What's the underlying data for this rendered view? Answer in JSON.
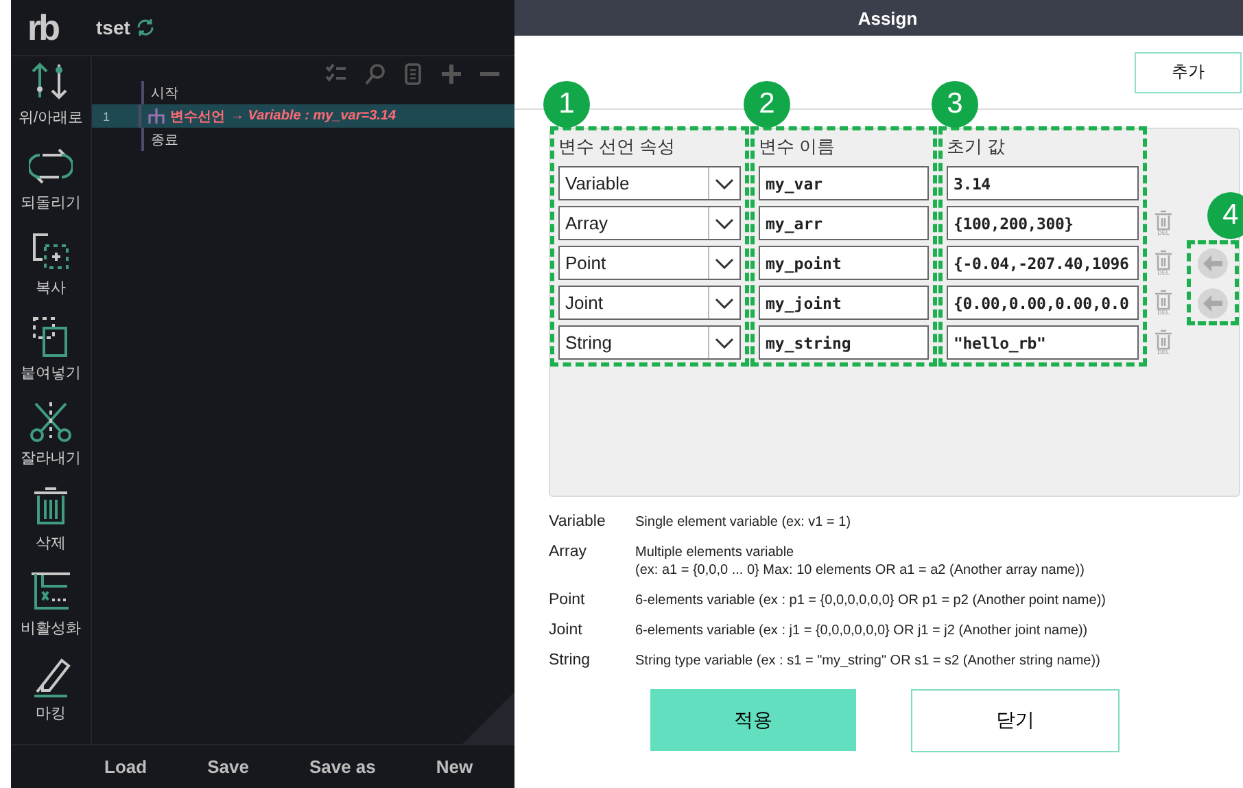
{
  "editor": {
    "logo": "rb",
    "project": "tset"
  },
  "toolbar": [
    {
      "label": "위/아래로"
    },
    {
      "label": "되돌리기"
    },
    {
      "label": "복사"
    },
    {
      "label": "붙여넣기"
    },
    {
      "label": "잘라내기"
    },
    {
      "label": "삭제"
    },
    {
      "label": "비활성화"
    },
    {
      "label": "마킹"
    }
  ],
  "tree": [
    {
      "kind": "start",
      "label": "시작",
      "selected": false
    },
    {
      "kind": "command",
      "number": "1",
      "label": "변수선언",
      "detail": "→ Variable : my_var=3.14",
      "selected": true
    },
    {
      "kind": "end",
      "label": "종료",
      "selected": false
    }
  ],
  "bottom_bar": [
    "Load",
    "Save",
    "Save as",
    "New"
  ],
  "dialog": {
    "title": "Assign",
    "add_button": "추가",
    "columns": [
      "변수 선언 속성",
      "변수 이름",
      "초기 값"
    ],
    "rows": [
      {
        "type": "Variable",
        "name": "my_var",
        "value": "3.14",
        "capture": false
      },
      {
        "type": "Array",
        "name": "my_arr",
        "value": "{100,200,300}",
        "delete_label": "DEL",
        "capture": false
      },
      {
        "type": "Point",
        "name": "my_point",
        "value": "{-0.04,-207.40,1096",
        "delete_label": "DEL",
        "capture": true
      },
      {
        "type": "Joint",
        "name": "my_joint",
        "value": "{0.00,0.00,0.00,0.0",
        "delete_label": "DEL",
        "capture": true
      },
      {
        "type": "String",
        "name": "my_string",
        "value": "\"hello_rb\"",
        "delete_label": "DEL",
        "capture": false
      }
    ],
    "markers": [
      "1",
      "2",
      "3",
      "4"
    ],
    "legend": [
      {
        "term": "Variable",
        "description": "Single element variable (ex: v1 = 1)"
      },
      {
        "term": "Array",
        "description": "Multiple elements variable\n(ex: a1 = {0,0,0 ... 0} Max: 10 elements OR a1 = a2 (Another array name))"
      },
      {
        "term": "Point",
        "description": "6-elements variable (ex : p1 = {0,0,0,0,0,0}  OR  p1 = p2 (Another point name))"
      },
      {
        "term": "Joint",
        "description": "6-elements variable (ex : j1 = {0,0,0,0,0,0}  OR  j1 = j2 (Another joint name))"
      },
      {
        "term": "String",
        "description": "String type variable (ex : s1 = \"my_string\"  OR  s1 = s2 (Another string name))"
      }
    ],
    "apply_button": "적용",
    "close_button": "닫기"
  }
}
